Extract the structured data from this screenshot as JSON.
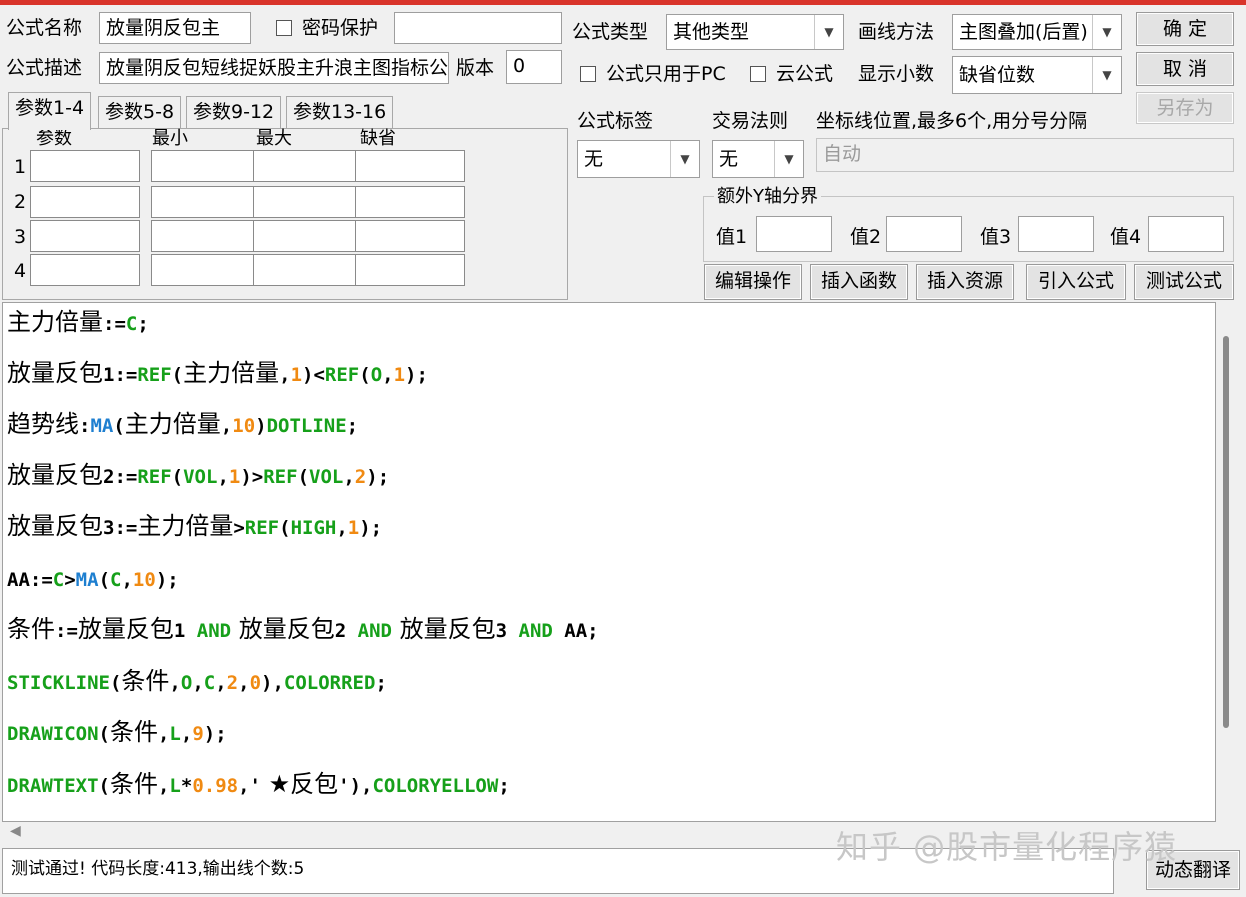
{
  "header": {
    "name_label": "公式名称",
    "name_value": "放量阴反包主",
    "password_label": "密码保护",
    "desc_label": "公式描述",
    "desc_value": "放量阴反包短线捉妖股主升浪主图指标公",
    "version_label": "版本",
    "version_value": "0",
    "type_label": "公式类型",
    "type_value": "其他类型",
    "draw_label": "画线方法",
    "draw_value": "主图叠加(后置)",
    "pc_only_label": "公式只用于PC",
    "cloud_label": "云公式",
    "decimal_label": "显示小数",
    "decimal_value": "缺省位数"
  },
  "buttons": {
    "ok": "确  定",
    "cancel": "取  消",
    "save_as": "另存为",
    "edit": "编辑操作",
    "insert_func": "插入函数",
    "insert_res": "插入资源",
    "import": "引入公式",
    "test": "测试公式",
    "dynamic": "动态翻译"
  },
  "tabs": [
    "参数1-4",
    "参数5-8",
    "参数9-12",
    "参数13-16"
  ],
  "param_table": {
    "headers": [
      "参数",
      "最小",
      "最大",
      "缺省"
    ],
    "rows": [
      "1",
      "2",
      "3",
      "4"
    ]
  },
  "right_panel": {
    "tag_label": "公式标签",
    "tag_value": "无",
    "rule_label": "交易法则",
    "rule_value": "无",
    "coord_label": "坐标线位置,最多6个,用分号分隔",
    "coord_value": "自动",
    "yaxis_group": "额外Y轴分界",
    "v1": "值1",
    "v2": "值2",
    "v3": "值3",
    "v4": "值4"
  },
  "code": {
    "l1": [
      "主力倍量",
      ":=",
      "C",
      ";"
    ],
    "l2": [
      "放量反包",
      "1:=",
      "REF",
      "(",
      "主力倍量",
      ",",
      "1",
      ")<",
      "REF",
      "(",
      "O",
      ",",
      "1",
      ");"
    ],
    "l3": [
      "趋势线",
      ":",
      "MA",
      "(",
      "主力倍量",
      ",",
      "10",
      ")",
      "DOTLINE",
      ";"
    ],
    "l4": [
      "放量反包",
      "2:=",
      "REF",
      "(",
      "VOL",
      ",",
      "1",
      ")>",
      "REF",
      "(",
      "VOL",
      ",",
      "2",
      ");"
    ],
    "l5": [
      "放量反包",
      "3:=",
      "主力倍量",
      ">",
      "REF",
      "(",
      "HIGH",
      ",",
      "1",
      ");"
    ],
    "l6": [
      "AA:=",
      "C",
      ">",
      "MA",
      "(",
      "C",
      ",",
      "10",
      ");"
    ],
    "l7": [
      "条件",
      ":=",
      "放量反包",
      "1 ",
      "AND",
      " ",
      "放量反包",
      "2 ",
      "AND",
      " ",
      "放量反包",
      "3 ",
      "AND",
      " AA;"
    ],
    "l8": [
      "STICKLINE",
      "(",
      "条件",
      ",",
      "O",
      ",",
      "C",
      ",",
      "2",
      ",",
      "0",
      "),",
      "COLORRED",
      ";"
    ],
    "l9": [
      "DRAWICON",
      "(",
      "条件",
      ",",
      "L",
      ",",
      "9",
      ");"
    ],
    "l10": [
      "DRAWTEXT",
      "(",
      "条件",
      ",",
      "L",
      "*",
      "0.98",
      ",'",
      " ★反包",
      "'),",
      "COLORYELLOW",
      ";"
    ]
  },
  "status": "测试通过! 代码长度:413,输出线个数:5",
  "watermark": "知乎 @股市量化程序猿",
  "colors": {
    "keyword": "#16a01a",
    "function": "#1e7fd0",
    "number": "#f08a12",
    "title_bar": "#d9342b"
  }
}
